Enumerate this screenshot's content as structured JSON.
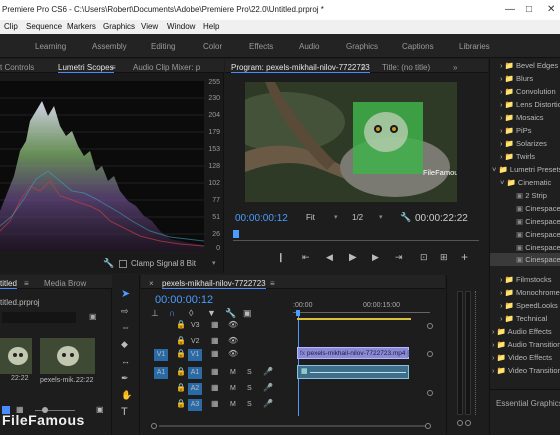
{
  "titlebar": {
    "title": "Premiere Pro CS6  -  C:\\Users\\Robert\\Documents\\Adobe\\Premiere Pro\\22.0\\Untitled.prproj *"
  },
  "menu": [
    "Clip",
    "Sequence",
    "Markers",
    "Graphics",
    "View",
    "Window",
    "Help"
  ],
  "workspaces": [
    "Learning",
    "Assembly",
    "Editing",
    "Color",
    "Effects",
    "Audio",
    "Graphics",
    "Captions",
    "Libraries"
  ],
  "scopes": {
    "tab_prev": "t Controls",
    "tab_active": "Lumetri Scopes",
    "tab_next": "Audio Clip Mixer: p",
    "scale": [
      "255",
      "230",
      "204",
      "179",
      "153",
      "128",
      "102",
      "77",
      "51",
      "26",
      "0"
    ],
    "clamp_label": "Clamp Signal",
    "bit_depth": "8 Bit"
  },
  "program": {
    "title": "Program: pexels-mikhail-nilov-7722723",
    "title2": "Title: (no title)",
    "timecode_in": "00:00:00:12",
    "fit": "Fit",
    "resolution": "1/2",
    "timecode_out": "00:00:22:22",
    "watermark": "FileFamous"
  },
  "effects": {
    "items": [
      "Bevel Edges",
      "Blurs",
      "Convolution",
      "Lens Distortion",
      "Mosaics",
      "PiPs",
      "Solarizes",
      "Twirls",
      "Lumetri Presets",
      "Cinematic",
      "2 Strip",
      "Cinespace",
      "Cinespace",
      "Cinespace",
      "Cinespace",
      "Cinespace",
      "Filmstocks",
      "Monochrome",
      "SpeedLooks",
      "Technical",
      "Audio Effects",
      "Audio Transitions",
      "Video Effects",
      "Video Transitions"
    ],
    "footer": "Essential Graphics"
  },
  "project": {
    "tab1": "titled",
    "tab2": "Media Brow",
    "file": "titled.prproj",
    "thumb1_time": "22:22",
    "thumb2_label": "pexels-mik...",
    "thumb2_time": "22:22"
  },
  "timeline": {
    "seq_name": "pexels-mikhail-nilov-7722723",
    "timecode": "00:00:00:12",
    "ruler0": ":00:00",
    "ruler1": "00:00:15:00",
    "tracks": [
      "V3",
      "V2",
      "V1",
      "A1",
      "A2",
      "A3"
    ],
    "clip_label": "pexels-mikhail-nilov-7722723.mp4 [V]",
    "m": "M",
    "s": "S"
  },
  "watermark": "FileFamous"
}
